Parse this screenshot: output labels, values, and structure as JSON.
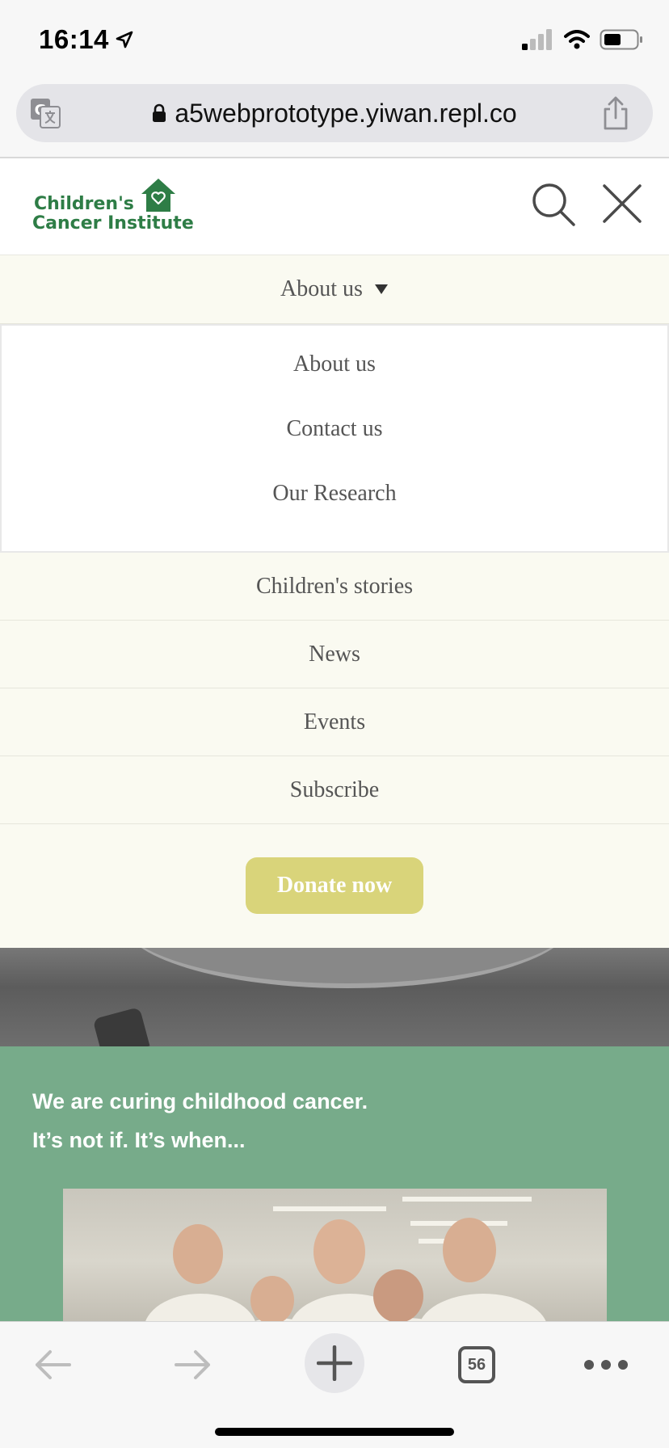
{
  "status_bar": {
    "time": "16:14",
    "icons": [
      "location-arrow-icon",
      "signal-icon",
      "wifi-icon",
      "battery-icon"
    ]
  },
  "browser": {
    "url": "a5webprototype.yiwan.repl.co",
    "icons": [
      "translate-icon",
      "lock-icon",
      "share-icon"
    ]
  },
  "site_header": {
    "logo_line1": "Children's",
    "logo_line2": "Cancer Institute",
    "icons": [
      "search-icon",
      "close-icon"
    ],
    "brand_color": "#2e7d46"
  },
  "nav": {
    "parent_label": "About us",
    "submenu": [
      "About us",
      "Contact us",
      "Our Research"
    ],
    "items": [
      "Children's stories",
      "News",
      "Events",
      "Subscribe"
    ],
    "donate_label": "Donate now",
    "donate_color": "#d9d47a"
  },
  "hero": {
    "tagline_line1": "We are curing childhood cancer.",
    "tagline_line2": "It’s not if. It’s when...",
    "section_color": "#77ab8a"
  },
  "toolbar": {
    "tabs_count": "56",
    "icons": [
      "back-arrow-icon",
      "forward-arrow-icon",
      "new-tab-icon",
      "tabs-icon",
      "more-icon"
    ]
  }
}
